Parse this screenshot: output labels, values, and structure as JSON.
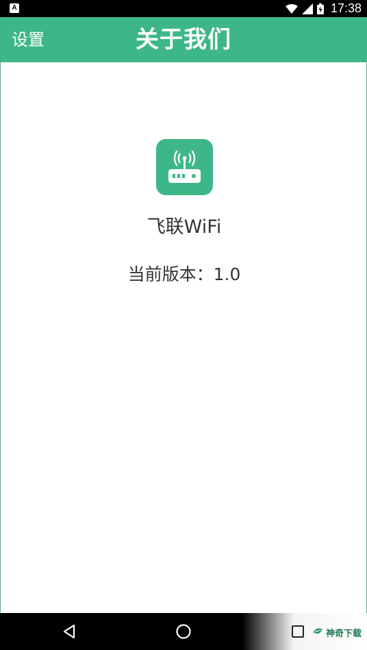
{
  "status_bar": {
    "time": "17:38",
    "notification_badge": "A",
    "icons": [
      "wifi-icon",
      "signal-icon",
      "battery-icon"
    ]
  },
  "app_bar": {
    "back_label": "设置",
    "title": "关于我们"
  },
  "about": {
    "app_icon": "router-icon",
    "app_name": "飞联WiFi",
    "version": "当前版本：1.0"
  },
  "nav_bar": {
    "icons": [
      "back-triangle-icon",
      "home-circle-icon",
      "recent-square-icon"
    ],
    "watermark": "神奇下载"
  },
  "colors": {
    "accent": "#3db787",
    "text": "#333333",
    "background": "#ffffff"
  }
}
